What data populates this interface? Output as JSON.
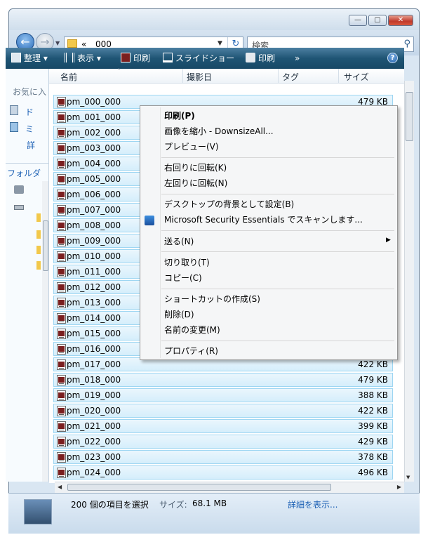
{
  "window": {
    "minimize_label": "—",
    "maximize_label": "▢",
    "close_label": "✕"
  },
  "address": {
    "chevrons": "«",
    "path": "000",
    "search_placeholder": "検索"
  },
  "toolbar": {
    "organize": "整理",
    "views": "表示",
    "print1": "印刷",
    "slideshow": "スライドショー",
    "print2": "印刷",
    "more": "»"
  },
  "left_pane": {
    "favorites": "お気に入",
    "item1": "ド",
    "item2": "ミ",
    "item3": "詳",
    "folders": "フォルダ"
  },
  "columns": {
    "name": "名前",
    "date": "撮影日",
    "tags": "タグ",
    "size": "サイズ"
  },
  "files": [
    {
      "name": "pm_000_000",
      "size": "479 KB"
    },
    {
      "name": "pm_001_000",
      "size": ""
    },
    {
      "name": "pm_002_000",
      "size": ""
    },
    {
      "name": "pm_003_000",
      "size": ""
    },
    {
      "name": "pm_004_000",
      "size": ""
    },
    {
      "name": "pm_005_000",
      "size": ""
    },
    {
      "name": "pm_006_000",
      "size": ""
    },
    {
      "name": "pm_007_000",
      "size": ""
    },
    {
      "name": "pm_008_000",
      "size": ""
    },
    {
      "name": "pm_009_000",
      "size": ""
    },
    {
      "name": "pm_010_000",
      "size": ""
    },
    {
      "name": "pm_011_000",
      "size": ""
    },
    {
      "name": "pm_012_000",
      "size": ""
    },
    {
      "name": "pm_013_000",
      "size": ""
    },
    {
      "name": "pm_014_000",
      "size": ""
    },
    {
      "name": "pm_015_000",
      "size": ""
    },
    {
      "name": "pm_016_000",
      "size": ""
    },
    {
      "name": "pm_017_000",
      "size": "422 KB"
    },
    {
      "name": "pm_018_000",
      "size": "479 KB"
    },
    {
      "name": "pm_019_000",
      "size": "388 KB"
    },
    {
      "name": "pm_020_000",
      "size": "422 KB"
    },
    {
      "name": "pm_021_000",
      "size": "399 KB"
    },
    {
      "name": "pm_022_000",
      "size": "429 KB"
    },
    {
      "name": "pm_023_000",
      "size": "378 KB"
    },
    {
      "name": "pm_024_000",
      "size": "496 KB"
    }
  ],
  "context_menu": {
    "print": "印刷(P)",
    "downsize": "画像を縮小 - DownsizeAll...",
    "preview": "プレビュー(V)",
    "rotate_cw": "右回りに回転(K)",
    "rotate_ccw": "左回りに回転(N)",
    "set_background": "デスクトップの背景として設定(B)",
    "mse_scan": "Microsoft Security Essentials でスキャンします...",
    "send_to": "送る(N)",
    "cut": "切り取り(T)",
    "copy": "コピー(C)",
    "create_shortcut": "ショートカットの作成(S)",
    "delete": "削除(D)",
    "rename": "名前の変更(M)",
    "properties": "プロパティ(R)"
  },
  "status": {
    "selected": "200 個の項目を選択",
    "size_label": "サイズ:",
    "size_value": "68.1 MB",
    "details_link": "詳細を表示..."
  },
  "colors": {
    "toolbar_bg": "#1f5575",
    "row_selected_bg": "#d5eefb",
    "row_selected_border": "#9ed6f2",
    "link": "#1a5fb4"
  }
}
